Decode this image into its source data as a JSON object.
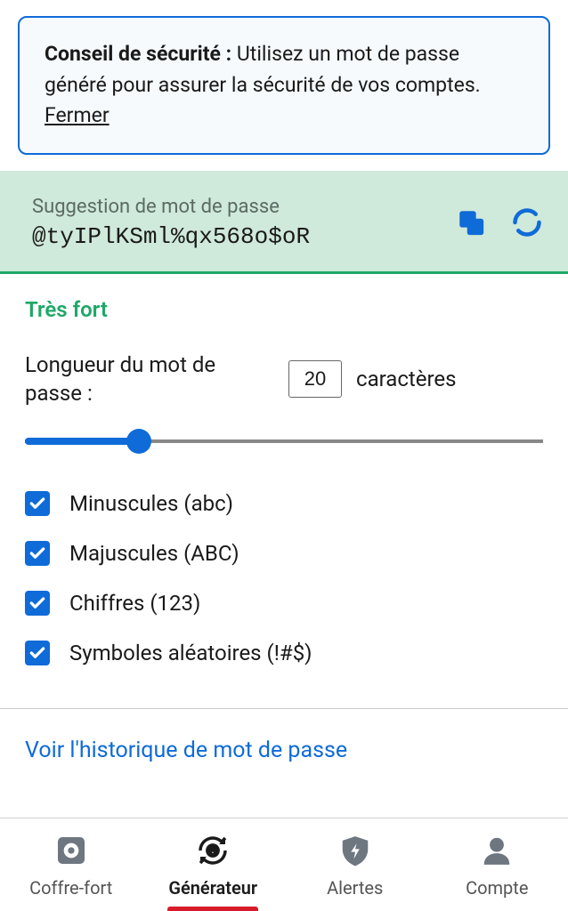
{
  "tip": {
    "strong": "Conseil de sécurité :",
    "body": " Utilisez un mot de passe généré pour assurer la sécurité de vos comptes. ",
    "close": "Fermer"
  },
  "suggestion": {
    "label": "Suggestion de mot de passe",
    "password": "@tyIPlKSml%qx568o$oR"
  },
  "strength": "Très fort",
  "length": {
    "label": "Longueur du mot de passe :",
    "value": "20",
    "unit": "caractères"
  },
  "options": {
    "lowercase": "Minuscules (abc)",
    "uppercase": "Majuscules (ABC)",
    "digits": "Chiffres (123)",
    "symbols": "Symboles aléatoires (!#$)"
  },
  "history_link": "Voir l'historique de mot de passe",
  "tabs": {
    "vault": "Coffre-fort",
    "generator": "Générateur",
    "alerts": "Alertes",
    "account": "Compte"
  },
  "colors": {
    "accent": "#0e6bd8",
    "success": "#1fa868",
    "indicator": "#d81b2a"
  }
}
